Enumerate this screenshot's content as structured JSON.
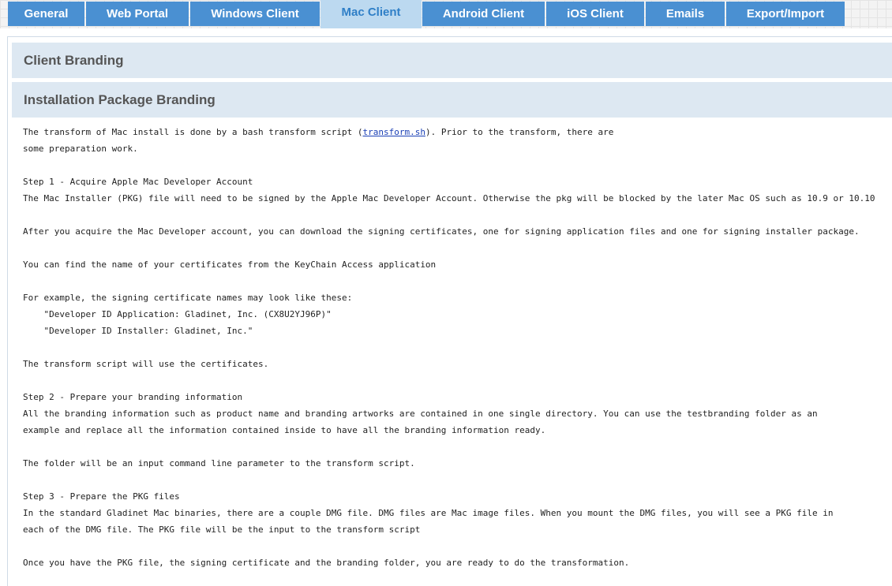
{
  "tabs": [
    {
      "label": "General",
      "active": false
    },
    {
      "label": "Web Portal",
      "active": false
    },
    {
      "label": "Windows Client",
      "active": false
    },
    {
      "label": "Mac Client",
      "active": true
    },
    {
      "label": "Android Client",
      "active": false
    },
    {
      "label": "iOS Client",
      "active": false
    },
    {
      "label": "Emails",
      "active": false
    },
    {
      "label": "Export/Import",
      "active": false
    }
  ],
  "sections": {
    "client_branding": "Client Branding",
    "installation_package_branding": "Installation Package Branding"
  },
  "content": {
    "intro_before_link": "The transform of Mac install is done by a bash transform script (",
    "intro_link": "transform.sh",
    "intro_after_link": "). Prior to the transform, there are",
    "intro_line2": "some preparation work.",
    "step1_title": "Step 1 - Acquire Apple Mac Developer Account",
    "step1_text": "The Mac Installer (PKG) file will need to be signed by the Apple Mac Developer Account. Otherwise the pkg will be blocked by the later Mac OS such as 10.9 or 10.10",
    "step1_para2": "After you acquire the Mac Developer account, you can download the signing certificates, one for signing application files and one for signing installer package.",
    "step1_para3": "You can find the name of your certificates from the KeyChain Access application",
    "example_intro": "For example, the signing certificate names may look like these:",
    "example_cert1": "    \"Developer ID Application: Gladinet, Inc. (CX8U2YJ96P)\"",
    "example_cert2": "    \"Developer ID Installer: Gladinet, Inc.\"",
    "certs_usage": "The transform script will use the certificates.",
    "step2_title": "Step 2 - Prepare your branding information",
    "step2_line1": "All the branding information such as product name and branding artworks are contained in one single directory. You can use the testbranding folder as an",
    "step2_line2": "example and replace all the information contained inside to have all the branding information ready.",
    "step2_para2": "The folder will be an input command line parameter to the transform script.",
    "step3_title": "Step 3 - Prepare the PKG files",
    "step3_line1": "In the standard Gladinet Mac binaries, there are a couple DMG file. DMG files are Mac image files. When you mount the DMG files, you will see a PKG file in",
    "step3_line2": "each of the DMG file. The PKG file will be the input to the transform script",
    "final_para": "Once you have the PKG file, the signing certificate and the branding folder, you are ready to do the transformation."
  },
  "colors": {
    "tab_bg": "#4a90d2",
    "tab_active_bg": "#bcd9f0",
    "tab_active_text": "#2f7fc7",
    "section_header_bg": "#dde8f2",
    "link": "#1a3fb5"
  }
}
